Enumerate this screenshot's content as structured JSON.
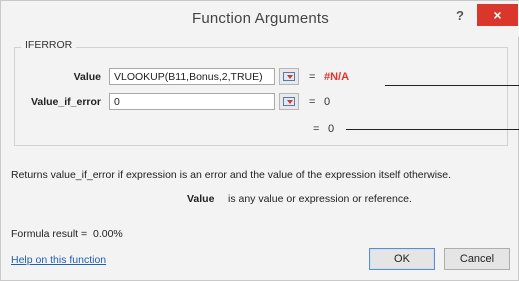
{
  "dialog": {
    "title": "Function Arguments",
    "help_symbol": "?",
    "close_symbol": "×"
  },
  "function": {
    "name": "IFERROR",
    "arguments": [
      {
        "label": "Value",
        "input": "VLOOKUP(B11,Bonus,2,TRUE)",
        "result": "#N/A"
      },
      {
        "label": "Value_if_error",
        "input": "0",
        "result": "0"
      }
    ],
    "overall_result": "0",
    "description": "Returns value_if_error if expression is an error and the value of the expression itself otherwise.",
    "arg_description_label": "Value",
    "arg_description_text": "is any value or expression or reference."
  },
  "formula": {
    "prefix": "Formula result =",
    "value": "0.00%"
  },
  "footer": {
    "help_link": "Help on this function",
    "ok_label": "OK",
    "cancel_label": "Cancel"
  },
  "colors": {
    "error_result": "#e3322b",
    "close_button": "#d9362c",
    "link": "#1f5fb4"
  },
  "icons": [
    "collapse-dialog-icon"
  ]
}
